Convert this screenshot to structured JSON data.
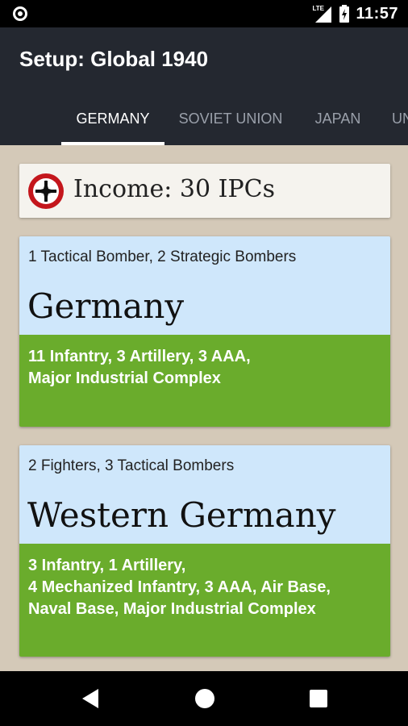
{
  "status_bar": {
    "network": "LTE",
    "time": "11:57"
  },
  "app_bar": {
    "title": "Setup: Global 1940"
  },
  "tabs": [
    {
      "label": "GERMANY",
      "active": true
    },
    {
      "label": "SOVIET UNION",
      "active": false
    },
    {
      "label": "JAPAN",
      "active": false
    },
    {
      "label": "UNITED STATES",
      "active": false
    }
  ],
  "income": {
    "text": "Income: 30 IPCs",
    "flag_icon": "germany-flag-icon"
  },
  "territories": [
    {
      "air_units": "1 Tactical Bomber, 2 Strategic Bombers",
      "name": "Germany",
      "ground_units": [
        "11 Infantry, 3 Artillery, 3 AAA,",
        "Major Industrial Complex"
      ]
    },
    {
      "air_units": "2 Fighters, 3 Tactical Bombers",
      "name": "Western Germany",
      "ground_units": [
        "3 Infantry, 1 Artillery,",
        "4 Mechanized Infantry, 3 AAA, Air Base,",
        "Naval Base, Major Industrial Complex"
      ]
    }
  ],
  "colors": {
    "app_bar": "#242830",
    "background": "#d4c9b8",
    "air_section": "#cfe7fb",
    "ground_section": "#6aac2c"
  }
}
